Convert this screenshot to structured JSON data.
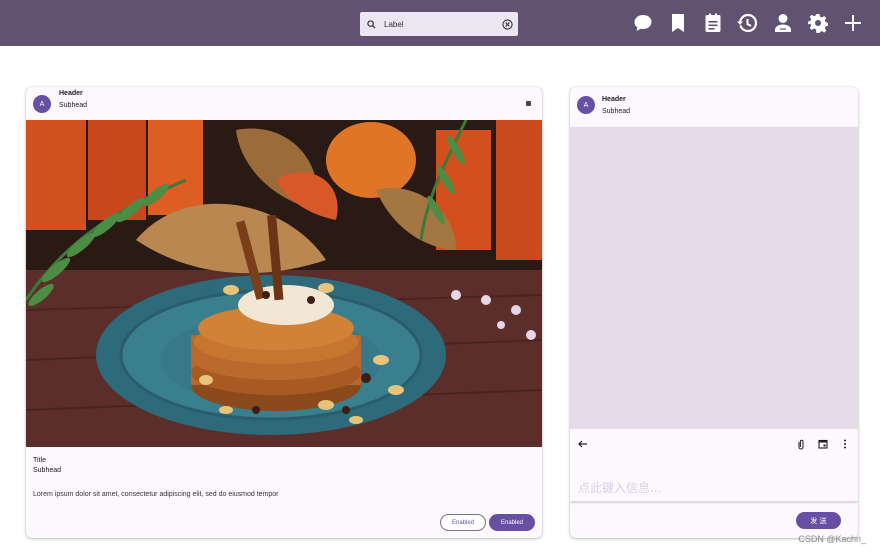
{
  "search": {
    "value": "Label",
    "icon": "search-icon",
    "clear_icon": "clear-icon"
  },
  "topbar": {
    "color": "#605270",
    "actions": [
      "chat-bubble-icon",
      "bookmark-icon",
      "notepad-icon",
      "history-icon",
      "person-icon",
      "settings-icon",
      "add-icon"
    ]
  },
  "card_media": {
    "avatar": "A",
    "header": "Header",
    "subhead": "Subhead",
    "image_icon": "photo-pancakes",
    "title": "Title",
    "subtitle": "Subhead",
    "body": "Lorem ipsum dolor sit amet, consectetur adipiscing elit, sed do eiusmod tempor",
    "btn_outlined": "Enabled",
    "btn_filled": "Enabled"
  },
  "card_chat": {
    "avatar": "A",
    "header": "Header",
    "subhead": "Subhead",
    "input_placeholder": "点此键入信息...",
    "input_value": "",
    "send_label": "发 送",
    "toolbar_icons": [
      "back-arrow-icon",
      "attachment-icon",
      "calendar-icon",
      "more-vert-icon"
    ]
  },
  "watermark": "CSDN @Kachn_",
  "accent": "#6750a4"
}
